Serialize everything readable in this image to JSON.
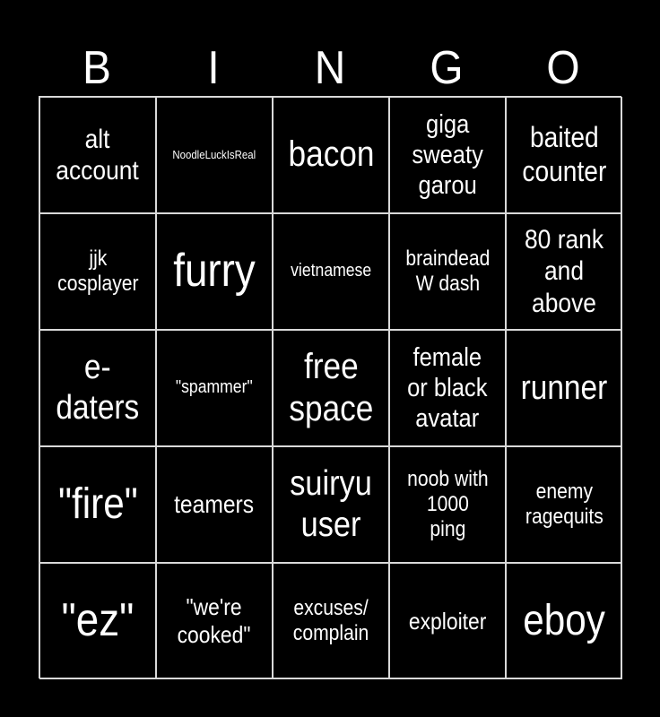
{
  "header": {
    "letters": [
      "B",
      "I",
      "N",
      "G",
      "O"
    ]
  },
  "board": {
    "cells": [
      {
        "text": "alt\naccount",
        "size": 30
      },
      {
        "text": "NoodleLuckIsReal",
        "size": 13
      },
      {
        "text": "bacon",
        "size": 40
      },
      {
        "text": "giga\nsweaty\ngarou",
        "size": 29
      },
      {
        "text": "baited\ncounter",
        "size": 32
      },
      {
        "text": "jjk\ncosplayer",
        "size": 24
      },
      {
        "text": "furry",
        "size": 52
      },
      {
        "text": "vietnamese",
        "size": 20
      },
      {
        "text": "braindead\nW dash",
        "size": 24
      },
      {
        "text": "80 rank\nand\nabove",
        "size": 30
      },
      {
        "text": "e-\ndaters",
        "size": 38
      },
      {
        "text": "\"spammer\"",
        "size": 20
      },
      {
        "text": "free\nspace",
        "size": 40
      },
      {
        "text": "female\nor black\navatar",
        "size": 29
      },
      {
        "text": "runner",
        "size": 38
      },
      {
        "text": "\"fire\"",
        "size": 48
      },
      {
        "text": "teamers",
        "size": 28
      },
      {
        "text": "suiryu\nuser",
        "size": 39
      },
      {
        "text": "noob with\n1000\nping",
        "size": 24
      },
      {
        "text": "enemy\nragequits",
        "size": 24
      },
      {
        "text": "\"ez\"",
        "size": 52
      },
      {
        "text": "\"we're\ncooked\"",
        "size": 26
      },
      {
        "text": "excuses/\ncomplain",
        "size": 24
      },
      {
        "text": "exploiter",
        "size": 26
      },
      {
        "text": "eboy",
        "size": 48
      }
    ]
  }
}
